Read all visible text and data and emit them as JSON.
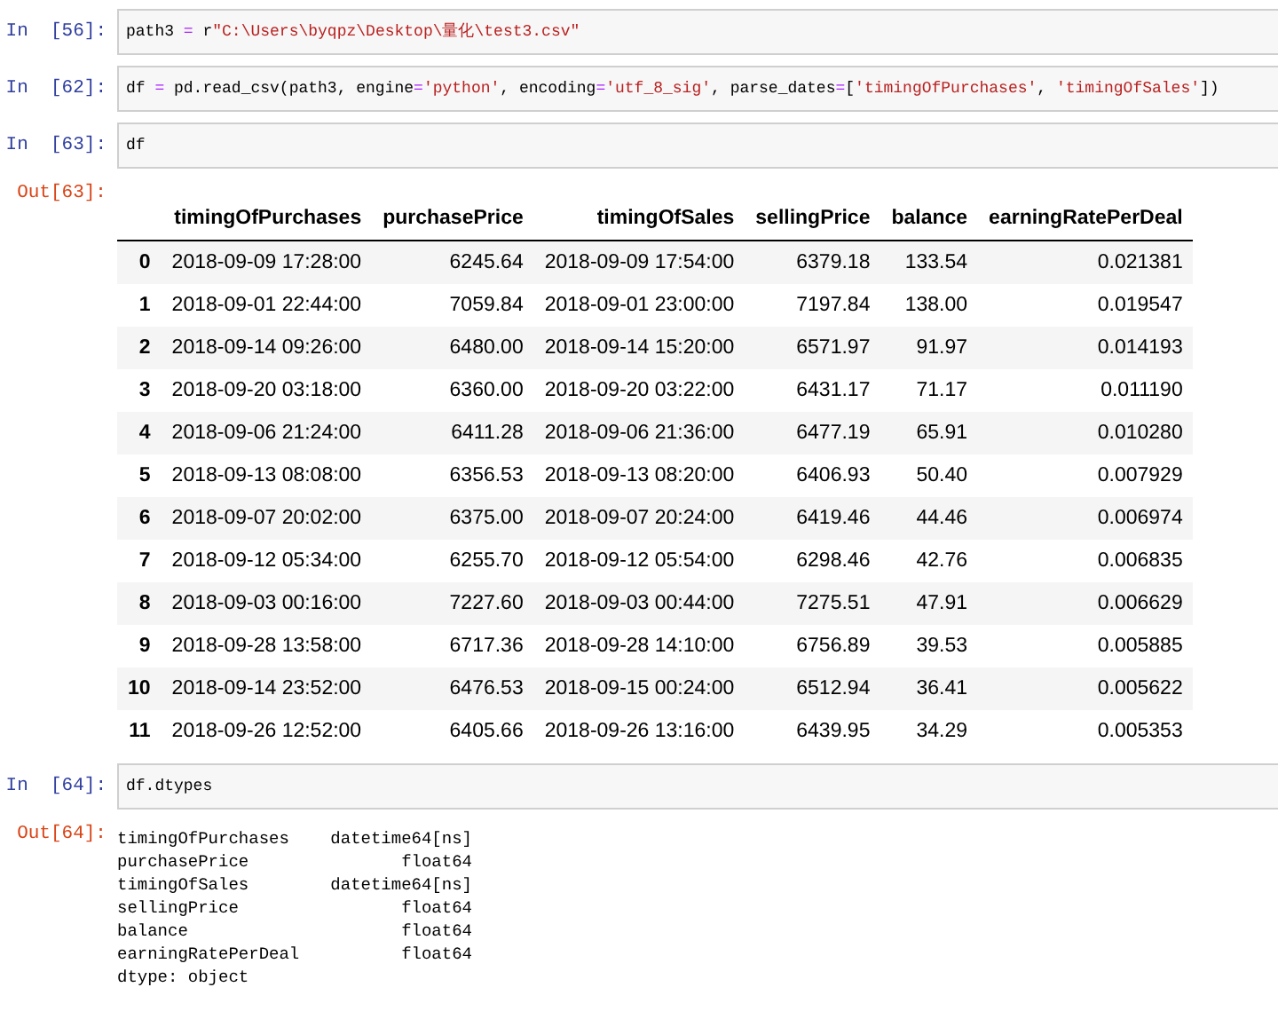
{
  "cells": [
    {
      "kind": "code",
      "prompt": "In  [56]:",
      "tokens": [
        {
          "kind": "plain",
          "text": "path3 "
        },
        {
          "kind": "op",
          "text": "="
        },
        {
          "kind": "plain",
          "text": " r"
        },
        {
          "kind": "string",
          "text": "\"C:\\Users\\byqpz\\Desktop\\量化\\test3.csv\""
        }
      ]
    },
    {
      "kind": "code",
      "prompt": "In  [62]:",
      "tokens": [
        {
          "kind": "plain",
          "text": "df "
        },
        {
          "kind": "op",
          "text": "="
        },
        {
          "kind": "plain",
          "text": " pd.read_csv(path3, engine"
        },
        {
          "kind": "op",
          "text": "="
        },
        {
          "kind": "string",
          "text": "'python'"
        },
        {
          "kind": "plain",
          "text": ", encoding"
        },
        {
          "kind": "op",
          "text": "="
        },
        {
          "kind": "string",
          "text": "'utf_8_sig'"
        },
        {
          "kind": "plain",
          "text": ", parse_dates"
        },
        {
          "kind": "op",
          "text": "="
        },
        {
          "kind": "plain",
          "text": "["
        },
        {
          "kind": "string",
          "text": "'timingOfPurchases'"
        },
        {
          "kind": "plain",
          "text": ", "
        },
        {
          "kind": "string",
          "text": "'timingOfSales'"
        },
        {
          "kind": "plain",
          "text": "])"
        }
      ]
    },
    {
      "kind": "code",
      "prompt": "In  [63]:",
      "tokens": [
        {
          "kind": "plain",
          "text": "df"
        }
      ]
    },
    {
      "kind": "table",
      "prompt": "Out[63]:",
      "columns": [
        "",
        "timingOfPurchases",
        "purchasePrice",
        "timingOfSales",
        "sellingPrice",
        "balance",
        "earningRatePerDeal"
      ],
      "rows": [
        [
          "0",
          "2018-09-09 17:28:00",
          "6245.64",
          "2018-09-09 17:54:00",
          "6379.18",
          "133.54",
          "0.021381"
        ],
        [
          "1",
          "2018-09-01 22:44:00",
          "7059.84",
          "2018-09-01 23:00:00",
          "7197.84",
          "138.00",
          "0.019547"
        ],
        [
          "2",
          "2018-09-14 09:26:00",
          "6480.00",
          "2018-09-14 15:20:00",
          "6571.97",
          "91.97",
          "0.014193"
        ],
        [
          "3",
          "2018-09-20 03:18:00",
          "6360.00",
          "2018-09-20 03:22:00",
          "6431.17",
          "71.17",
          "0.011190"
        ],
        [
          "4",
          "2018-09-06 21:24:00",
          "6411.28",
          "2018-09-06 21:36:00",
          "6477.19",
          "65.91",
          "0.010280"
        ],
        [
          "5",
          "2018-09-13 08:08:00",
          "6356.53",
          "2018-09-13 08:20:00",
          "6406.93",
          "50.40",
          "0.007929"
        ],
        [
          "6",
          "2018-09-07 20:02:00",
          "6375.00",
          "2018-09-07 20:24:00",
          "6419.46",
          "44.46",
          "0.006974"
        ],
        [
          "7",
          "2018-09-12 05:34:00",
          "6255.70",
          "2018-09-12 05:54:00",
          "6298.46",
          "42.76",
          "0.006835"
        ],
        [
          "8",
          "2018-09-03 00:16:00",
          "7227.60",
          "2018-09-03 00:44:00",
          "7275.51",
          "47.91",
          "0.006629"
        ],
        [
          "9",
          "2018-09-28 13:58:00",
          "6717.36",
          "2018-09-28 14:10:00",
          "6756.89",
          "39.53",
          "0.005885"
        ],
        [
          "10",
          "2018-09-14 23:52:00",
          "6476.53",
          "2018-09-15 00:24:00",
          "6512.94",
          "36.41",
          "0.005622"
        ],
        [
          "11",
          "2018-09-26 12:52:00",
          "6405.66",
          "2018-09-26 13:16:00",
          "6439.95",
          "34.29",
          "0.005353"
        ]
      ]
    },
    {
      "kind": "code",
      "prompt": "In  [64]:",
      "tokens": [
        {
          "kind": "plain",
          "text": "df.dtypes"
        }
      ]
    },
    {
      "kind": "series",
      "prompt": "Out[64]:",
      "rows": [
        [
          "timingOfPurchases",
          "datetime64[ns]"
        ],
        [
          "purchasePrice",
          "float64"
        ],
        [
          "timingOfSales",
          "datetime64[ns]"
        ],
        [
          "sellingPrice",
          "float64"
        ],
        [
          "balance",
          "float64"
        ],
        [
          "earningRatePerDeal",
          "float64"
        ]
      ],
      "footer": "dtype: object"
    }
  ]
}
